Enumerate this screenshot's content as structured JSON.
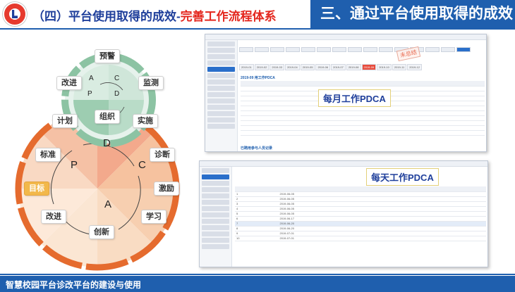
{
  "header": {
    "title_left_blue": "（四）平台使用取得的成效-",
    "title_left_red": "完善工作流程体系",
    "title_right": "三、通过平台使用取得的成效"
  },
  "diagram": {
    "small_cycle": {
      "labels": [
        "预警",
        "监测",
        "组织",
        "改进"
      ],
      "letters": [
        "A",
        "C",
        "P",
        "D"
      ]
    },
    "big_cycle": {
      "labels": [
        "计划",
        "实施",
        "诊断",
        "激励",
        "学习",
        "创新",
        "改进",
        "目标",
        "标准"
      ],
      "letters": [
        "D",
        "C",
        "A",
        "P"
      ]
    },
    "highlight_color": "#f2b84b"
  },
  "monthly": {
    "overlay": "每月工作PDCA",
    "stamp": "未总结",
    "months": [
      "2019-01",
      "2019-02",
      "2019-03",
      "2019-04",
      "2019-05",
      "2019-06",
      "2019-07",
      "2019-08",
      "2019-09",
      "2019-10",
      "2019-11",
      "2019-12"
    ],
    "active_month": "2019-09",
    "section1": "2019-09 用工作PDCA",
    "section2": "已聘用参与人员记录"
  },
  "daily": {
    "overlay": "每天工作PDCA",
    "rows": [
      {
        "n": "1",
        "date": "2019-06-05"
      },
      {
        "n": "2",
        "date": "2019-06-05"
      },
      {
        "n": "3",
        "date": "2019-06-05"
      },
      {
        "n": "4",
        "date": "2019-06-05"
      },
      {
        "n": "5",
        "date": "2019-06-05"
      },
      {
        "n": "6",
        "date": "2019-06-17"
      },
      {
        "n": "7",
        "date": "2019-06-20"
      },
      {
        "n": "8",
        "date": "2019-06-20"
      },
      {
        "n": "9",
        "date": "2019-07-01"
      },
      {
        "n": "10",
        "date": "2019-07-01"
      }
    ]
  },
  "footer": {
    "text": "智慧校园平台诊改平台的建设与使用"
  }
}
